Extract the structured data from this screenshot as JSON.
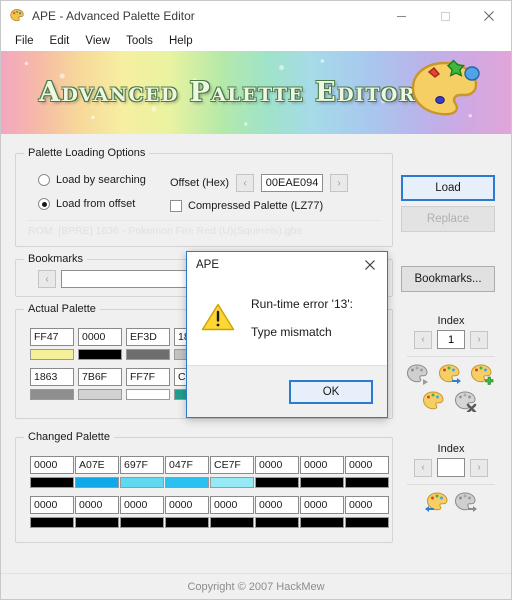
{
  "window": {
    "title": "APE - Advanced Palette Editor",
    "icon": "palette-icon",
    "controls": {
      "minimize": "–",
      "maximize": "☐",
      "close": "✕"
    }
  },
  "menu": {
    "items": [
      "File",
      "Edit",
      "View",
      "Tools",
      "Help"
    ]
  },
  "banner": {
    "title": "Advanced Palette Editor",
    "icon": "artist-palette-icon"
  },
  "loading_options": {
    "group_label": "Palette Loading Options",
    "radios": [
      {
        "label": "Load by searching",
        "checked": false
      },
      {
        "label": "Load from offset",
        "checked": true
      }
    ],
    "offset": {
      "label": "Offset (Hex)",
      "value": "00EAE094",
      "prev": "‹",
      "next": "›"
    },
    "compressed": {
      "label": "Compressed Palette (LZ77)",
      "checked": false
    },
    "rom_info": "ROM: [BPRE] 1636 - Pokemon Fire Red (U)(Squirrels).gba"
  },
  "actions": {
    "load": {
      "label": "Load",
      "focused": true,
      "enabled": true
    },
    "replace": {
      "label": "Replace",
      "enabled": false
    },
    "bookmarks_button": {
      "label": "Bookmarks..."
    }
  },
  "bookmarks": {
    "group_label": "Bookmarks",
    "value": "",
    "prev": "‹"
  },
  "actual_palette": {
    "group_label": "Actual Palette",
    "rows": [
      [
        {
          "hex": "FF47",
          "color": "#f5f19a"
        },
        {
          "hex": "0000",
          "color": "#000000"
        },
        {
          "hex": "EF3D",
          "color": "#6e6e6e"
        },
        {
          "hex": "1863",
          "color": "#c2c2c2"
        }
      ],
      [
        {
          "hex": "1863",
          "color": "#8e8e8e"
        },
        {
          "hex": "7B6F",
          "color": "#d2d2d2"
        },
        {
          "hex": "FF7F",
          "color": "#ffffff"
        },
        {
          "hex": "C85F",
          "color": "#1fa08c"
        }
      ]
    ],
    "index": {
      "label": "Index",
      "value": "1",
      "prev": "‹",
      "next": "›"
    },
    "tool_icons": [
      "palette-grayscale-icon",
      "palette-import-icon",
      "palette-add-icon",
      "palette-edit-icon",
      "palette-settings-icon"
    ]
  },
  "changed_palette": {
    "group_label": "Changed Palette",
    "rows": [
      [
        {
          "hex": "0000",
          "color": "#000000"
        },
        {
          "hex": "A07E",
          "color": "#10a8e8"
        },
        {
          "hex": "697F",
          "color": "#5fd9ef"
        },
        {
          "hex": "047F",
          "color": "#29c2f0"
        },
        {
          "hex": "CE7F",
          "color": "#96eaf5"
        },
        {
          "hex": "0000",
          "color": "#000000"
        },
        {
          "hex": "0000",
          "color": "#000000"
        },
        {
          "hex": "0000",
          "color": "#000000"
        }
      ],
      [
        {
          "hex": "0000",
          "color": "#000000"
        },
        {
          "hex": "0000",
          "color": "#000000"
        },
        {
          "hex": "0000",
          "color": "#000000"
        },
        {
          "hex": "0000",
          "color": "#000000"
        },
        {
          "hex": "0000",
          "color": "#000000"
        },
        {
          "hex": "0000",
          "color": "#000000"
        },
        {
          "hex": "0000",
          "color": "#000000"
        },
        {
          "hex": "0000",
          "color": "#000000"
        }
      ]
    ],
    "index": {
      "label": "Index",
      "value": "",
      "prev": "‹",
      "next": "›"
    },
    "tool_icons": [
      "palette-restore-icon",
      "palette-undo-icon"
    ]
  },
  "footer": {
    "text": "Copyright © 2007 HackMew"
  },
  "dialog": {
    "title": "APE",
    "close": "✕",
    "icon": "warning-triangle-icon",
    "line1": "Run-time error '13':",
    "line2": "Type mismatch",
    "ok": "OK"
  },
  "colors": {
    "accent": "#2a7ad1",
    "warning": "#ffd633",
    "window_bg": "#f0f0f0"
  }
}
